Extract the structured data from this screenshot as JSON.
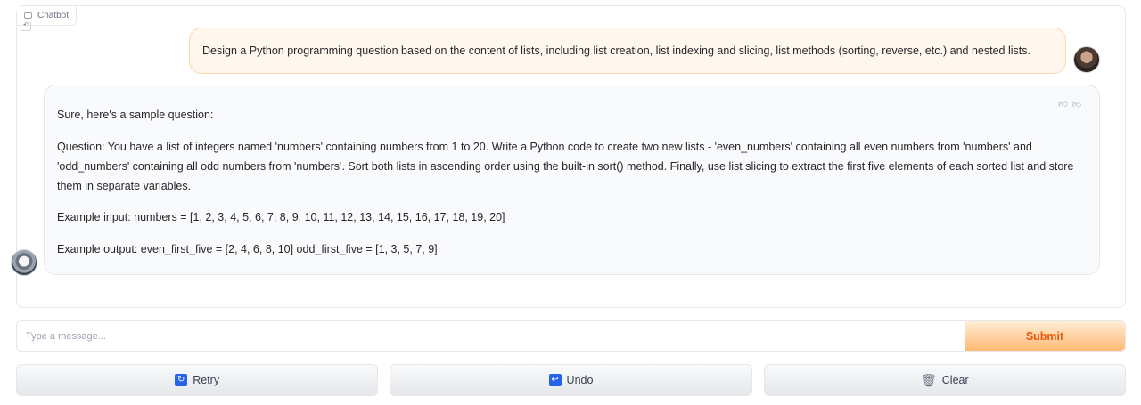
{
  "chatbot": {
    "label": "Chatbot"
  },
  "messages": {
    "user": "Design a Python programming question based on the content of lists, including list creation, list indexing and slicing, list methods (sorting, reverse, etc.) and nested lists.",
    "bot": {
      "intro": "Sure, here's a sample question:",
      "question": "Question: You have a list of integers named 'numbers' containing numbers from 1 to 20. Write a Python code to create two new lists - 'even_numbers' containing all even numbers from 'numbers' and 'odd_numbers' containing all odd numbers from 'numbers'. Sort both lists in ascending order using the built-in sort() method. Finally, use list slicing to extract the first five elements of each sorted list and store them in separate variables.",
      "example_input": "Example input: numbers = [1, 2, 3, 4, 5, 6, 7, 8, 9, 10, 11, 12, 13, 14, 15, 16, 17, 18, 19, 20]",
      "example_output": "Example output: even_first_five = [2, 4, 6, 8, 10] odd_first_five = [1, 3, 5, 7, 9]"
    }
  },
  "input": {
    "placeholder": "Type a message...",
    "submit_label": "Submit"
  },
  "buttons": {
    "retry": "Retry",
    "undo": "Undo",
    "clear": "Clear"
  },
  "icons": {
    "retry": "refresh-icon",
    "undo": "undo-icon",
    "clear": "trash-icon",
    "like": "thumbs-up-icon",
    "dislike": "thumbs-down-icon"
  },
  "colors": {
    "accent": "#ea580c",
    "user_bubble": "#fff7ed",
    "icon_blue": "#2563eb"
  }
}
